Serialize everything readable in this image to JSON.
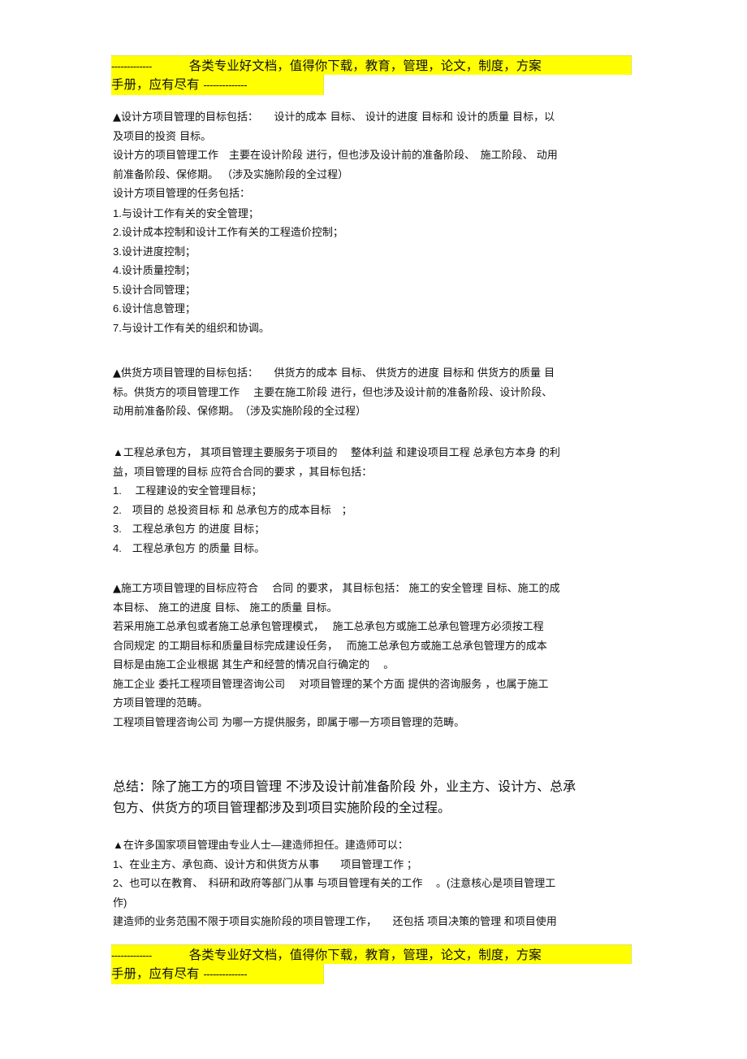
{
  "banner": {
    "dash_left": "-------------",
    "line1_text": "各类专业好文档，值得你下载，教育，管理，论文，制度，方案",
    "line2_text": "手册，应有尽有",
    "dash_right": "--------------"
  },
  "sections": {
    "design": {
      "lines": [
        "▲设计方项目管理的目标包括：　　设计的成本  目标、 设计的进度  目标和 设计的质量  目标，以",
        "及项目的投资  目标。",
        "设计方的项目管理工作　主要在设计阶段  进行，但也涉及设计前的准备阶段、　施工阶段、 动用",
        "前准备阶段、保修期。 （涉及实施阶段的全过程）",
        "设计方项目管理的任务包括："
      ],
      "tasks": [
        "1.与设计工作有关的安全管理；",
        "2.设计成本控制和设计工作有关的工程造价控制；",
        "3.设计进度控制；",
        "4.设计质量控制；",
        "5.设计合同管理；",
        "6.设计信息管理；",
        "7.与设计工作有关的组织和协调。"
      ]
    },
    "supplier": {
      "lines": [
        "▲供货方项目管理的目标包括：　　供货方的成本  目标、 供货方的进度  目标和 供货方的质量  目",
        "标。供货方的项目管理工作　 主要在施工阶段  进行，但也涉及设计前的准备阶段、设计阶段、",
        "动用前准备阶段、保修期。　（涉及实施阶段的全过程）"
      ]
    },
    "contractor": {
      "lines": [
        "▲工程总承包方， 其项目管理主要服务于项目的　 整体利益 和建设项目工程  总承包方本身  的利",
        "益，项目管理的目标  应符合合同的要求  ，其目标包括："
      ],
      "goals": [
        "1.　 工程建设的安全管理目标；",
        "2.　项目的 总投资目标  和 总承包方的成本目标　；",
        "3.　工程总承包方  的进度 目标；",
        "4.　工程总承包方  的质量 目标。"
      ]
    },
    "construction": {
      "lines": [
        "▲施工方项目管理的目标应符合　 合同 的要求， 其目标包括： 施工的安全管理  目标、施工的成",
        "本目标、 施工的进度  目标、 施工的质量  目标。",
        "若采用施工总承包或者施工总承包管理模式，　 施工总承包方或施工总承包管理方必须按工程",
        "合同规定  的工期目标和质量目标完成建设任务，　 而施工总承包方或施工总承包管理方的成本",
        "目标是由施工企业根据  其生产和经营的情况自行确定的　 。",
        "施工企业  委托工程项目管理咨询公司　 对项目管理的某个方面  提供的咨询服务  ，也属于施工",
        "方项目管理的范畴。",
        "工程项目管理咨询公司  为哪一方提供服务，即属于哪一方项目管理的范畴。"
      ]
    },
    "summary": {
      "lines": [
        "总结：除了施工方的项目管理  不涉及设计前准备阶段  外，业主方、设计方、总承",
        "包方、供货方的项目管理都涉及到项目实施阶段的全过程。"
      ]
    },
    "constructor": {
      "lines": [
        "▲在许多国家项目管理由专业人士—建造师担任。建造师可以：",
        "1、在业主方、承包商、设计方和供货方从事　　项目管理工作  ；",
        "2、也可以在教育、　科研和政府等部门从事  与项目管理有关的工作　 。(注意核心是项目管理工",
        "作)",
        "建造师的业务范围不限于项目实施阶段的项目管理工作，　　还包括 项目决策的管理  和项目使用"
      ]
    }
  }
}
